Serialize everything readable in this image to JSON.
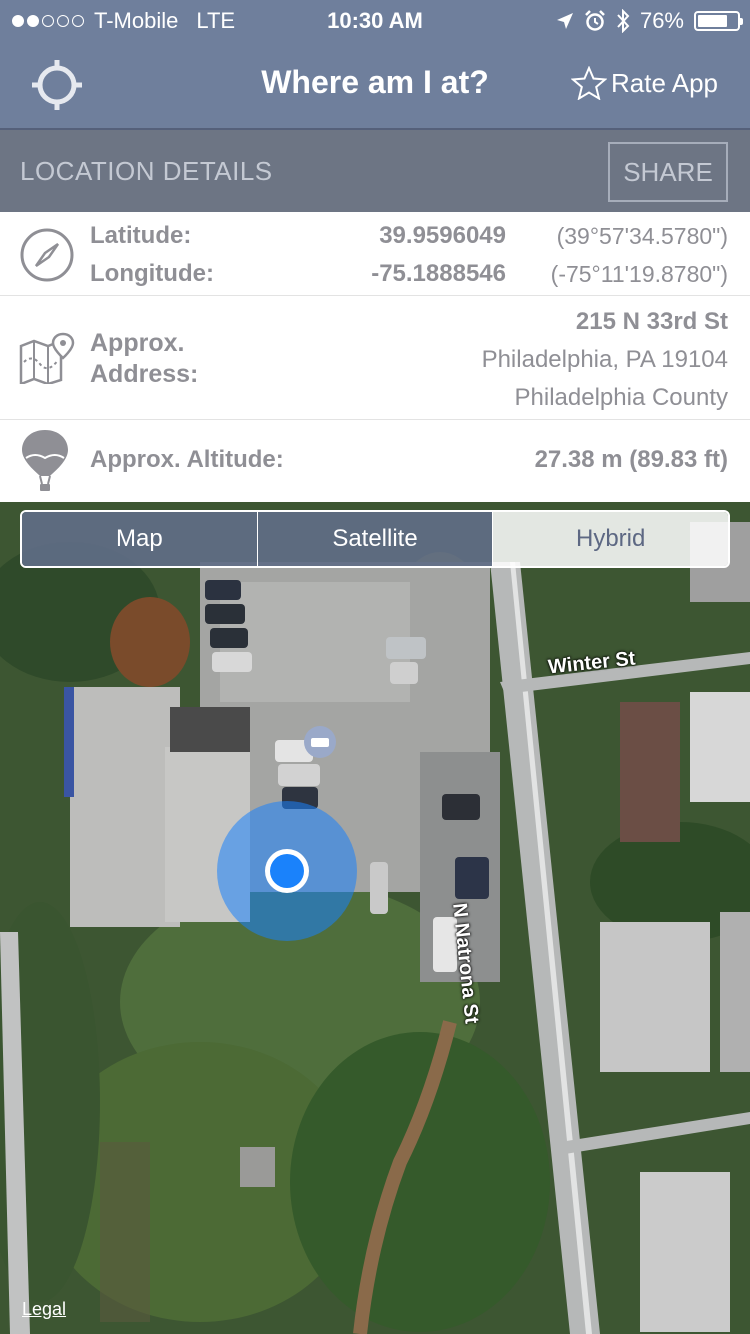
{
  "status_bar": {
    "carrier": "T-Mobile",
    "network": "LTE",
    "time": "10:30 AM",
    "battery": "76%",
    "battery_level": 0.76
  },
  "nav": {
    "title": "Where am I at?",
    "rate_label": "Rate App"
  },
  "details": {
    "header": "LOCATION DETAILS",
    "share_label": "SHARE"
  },
  "coords": {
    "latitude_label": "Latitude:",
    "latitude_value": "39.9596049",
    "latitude_dms": "(39°57'34.5780\")",
    "longitude_label": "Longitude:",
    "longitude_value": "-75.1888546",
    "longitude_dms": "(-75°11'19.8780\")"
  },
  "address": {
    "label_line1": "Approx.",
    "label_line2": "Address:",
    "street": "215 N 33rd St",
    "city": "Philadelphia, PA 19104",
    "county": "Philadelphia County"
  },
  "altitude": {
    "label": "Approx. Altitude:",
    "value": "27.38 m (89.83 ft)"
  },
  "map": {
    "modes": [
      "Map",
      "Satellite",
      "Hybrid"
    ],
    "selected_mode": "Hybrid",
    "streets": [
      "Winter St",
      "N Natrona St"
    ],
    "legal": "Legal"
  },
  "colors": {
    "nav_bg": "#6f7f9c",
    "details_bg": "#6d7584",
    "text_gray": "#8f8f95",
    "location_blue": "#1a82fb"
  }
}
